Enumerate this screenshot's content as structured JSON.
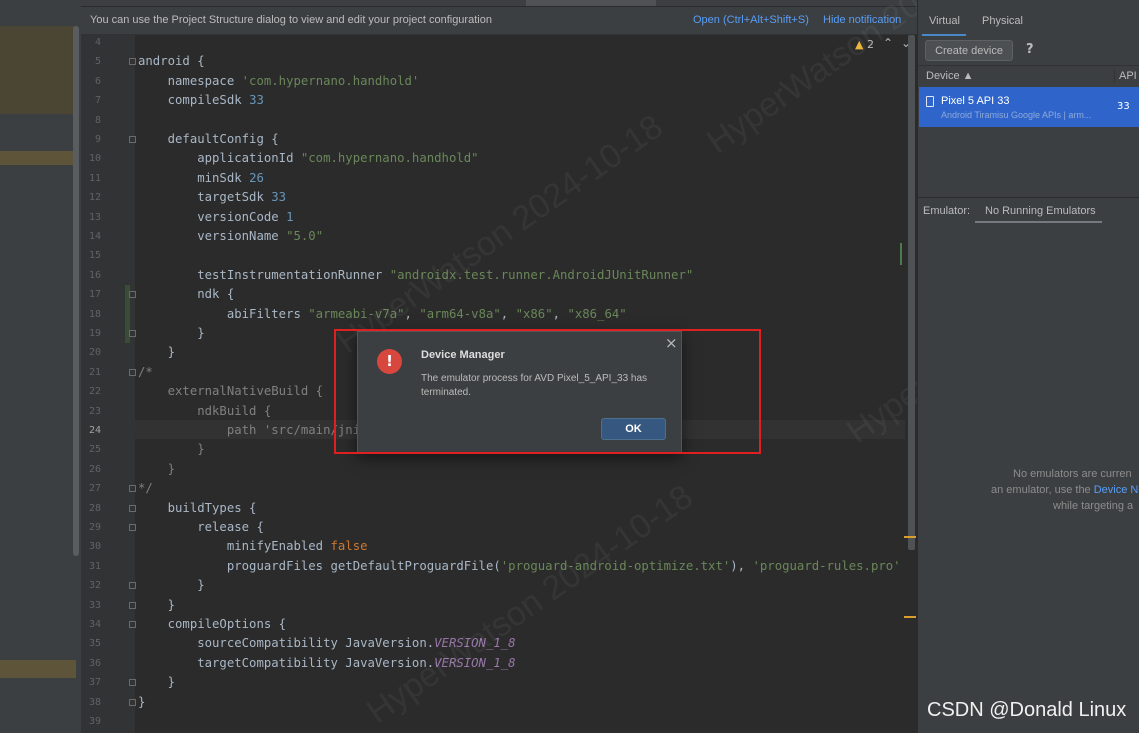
{
  "notification": {
    "text": "You can use the Project Structure dialog to view and edit your project configuration",
    "open_link": "Open (Ctrl+Alt+Shift+S)",
    "hide_link": "Hide notification"
  },
  "editor": {
    "warning_count": "2",
    "current_line": 24
  },
  "code_lines": [
    {
      "num": "4",
      "html": ""
    },
    {
      "num": "5",
      "html": "android {"
    },
    {
      "num": "6",
      "html": "    namespace <span class='s'>'com.hypernano.handhold'</span>"
    },
    {
      "num": "7",
      "html": "    compileSdk <span class='n'>33</span>"
    },
    {
      "num": "8",
      "html": ""
    },
    {
      "num": "9",
      "html": "    defaultConfig {"
    },
    {
      "num": "10",
      "html": "        applicationId <span class='s'>\"com.hypernano.handhold\"</span>"
    },
    {
      "num": "11",
      "html": "        minSdk <span class='n'>26</span>"
    },
    {
      "num": "12",
      "html": "        targetSdk <span class='n'>33</span>"
    },
    {
      "num": "13",
      "html": "        versionCode <span class='n'>1</span>"
    },
    {
      "num": "14",
      "html": "        versionName <span class='s'>\"5.0\"</span>"
    },
    {
      "num": "15",
      "html": ""
    },
    {
      "num": "16",
      "html": "        testInstrumentationRunner <span class='s'>\"androidx.test.runner.AndroidJUnitRunner\"</span>"
    },
    {
      "num": "17",
      "html": "        ndk {"
    },
    {
      "num": "18",
      "html": "            abiFilters <span class='s'>\"armeabi-v7a\"</span>, <span class='s'>\"arm64-v8a\"</span>, <span class='s'>\"x86\"</span>, <span class='s'>\"x86_64\"</span>"
    },
    {
      "num": "19",
      "html": "        }"
    },
    {
      "num": "20",
      "html": "    }"
    },
    {
      "num": "21",
      "html": "<span class='c'>/*</span>"
    },
    {
      "num": "22",
      "html": "<span class='c'>    externalNativeBuild {</span>"
    },
    {
      "num": "23",
      "html": "<span class='c'>        ndkBuild {</span>"
    },
    {
      "num": "24",
      "html": "<span class='c'>            path 'src/main/jni/</span>"
    },
    {
      "num": "25",
      "html": "<span class='c'>        }</span>"
    },
    {
      "num": "26",
      "html": "<span class='c'>    }</span>"
    },
    {
      "num": "27",
      "html": "<span class='c'>*/</span>"
    },
    {
      "num": "28",
      "html": "    buildTypes {"
    },
    {
      "num": "29",
      "html": "        release {"
    },
    {
      "num": "30",
      "html": "            minifyEnabled <span class='k'>false</span>"
    },
    {
      "num": "31",
      "html": "            proguardFiles getDefaultProguardFile(<span class='s'>'proguard-android-optimize.txt'</span>), <span class='s'>'proguard-rules.pro'</span>"
    },
    {
      "num": "32",
      "html": "        }"
    },
    {
      "num": "33",
      "html": "    }"
    },
    {
      "num": "34",
      "html": "    compileOptions {"
    },
    {
      "num": "35",
      "html": "        sourceCompatibility JavaVersion.<span class='i'>VERSION_1_8</span>"
    },
    {
      "num": "36",
      "html": "        targetCompatibility JavaVersion.<span class='i'>VERSION_1_8</span>"
    },
    {
      "num": "37",
      "html": "    }"
    },
    {
      "num": "38",
      "html": "}"
    },
    {
      "num": "39",
      "html": ""
    }
  ],
  "device_manager": {
    "tab_virtual": "Virtual",
    "tab_physical": "Physical",
    "create_device": "Create device",
    "help": "?",
    "col_device": "Device ▲",
    "col_api": "API",
    "device": {
      "name": "Pixel 5 API 33",
      "subtitle": "Android Tiramisu Google APIs | arm...",
      "api": "33"
    },
    "emulator_label": "Emulator:",
    "emulator_tab": "No Running Emulators",
    "empty_line1": "No emulators are curren",
    "empty_line2_pre": "an emulator, use the ",
    "empty_line2_link": "Device N",
    "empty_line3": "while targeting a"
  },
  "dialog": {
    "title": "Device Manager",
    "message": "The emulator process for AVD Pixel_5_API_33 has terminated.",
    "ok": "OK",
    "close": "×",
    "icon": "!"
  },
  "watermark": "CSDN @Donald Linux",
  "background_watermarks": [
    "HyperWatson 2024-10-18",
    "HyperWatson 2024-10-18",
    "HyperWatson 2024-10-18",
    "HyperWatson 2024-10-18"
  ],
  "colors": {
    "accent": "#2f65ca",
    "ok_button": "#365880",
    "error_icon": "#d7473e",
    "highlight_box": "#e02020"
  }
}
